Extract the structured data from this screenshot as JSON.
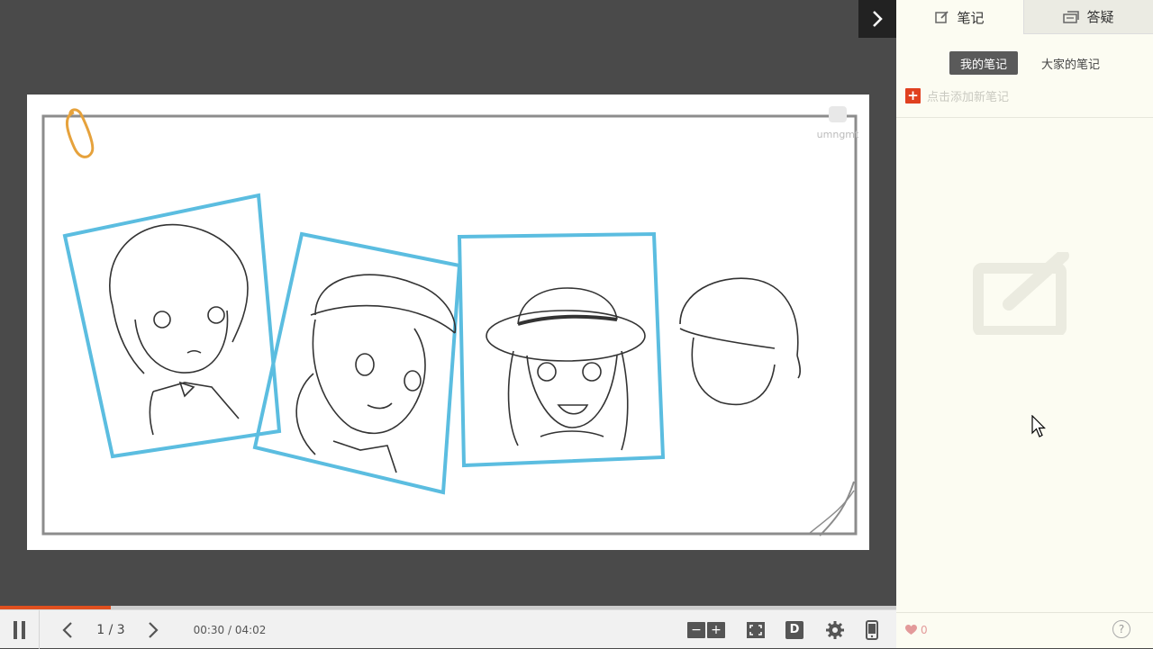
{
  "player": {
    "page": "1 / 3",
    "time": "00:30 / 04:02",
    "progress": 0.124,
    "zoom_out": "−",
    "zoom_in": "+",
    "danmaku": "D"
  },
  "slide": {
    "watermark": "umngmt"
  },
  "panel": {
    "tabs": [
      {
        "label": "笔记",
        "icon": "edit-icon"
      },
      {
        "label": "答疑",
        "icon": "qa-icon"
      }
    ],
    "subtabs": [
      "我的笔记",
      "大家的笔记"
    ],
    "add_note": "点击添加新笔记",
    "likes": "0",
    "help": "?"
  },
  "colors": {
    "accent": "#e0501f",
    "frame_blue": "#5bbde0",
    "panel_bg": "#fcfcf2"
  }
}
